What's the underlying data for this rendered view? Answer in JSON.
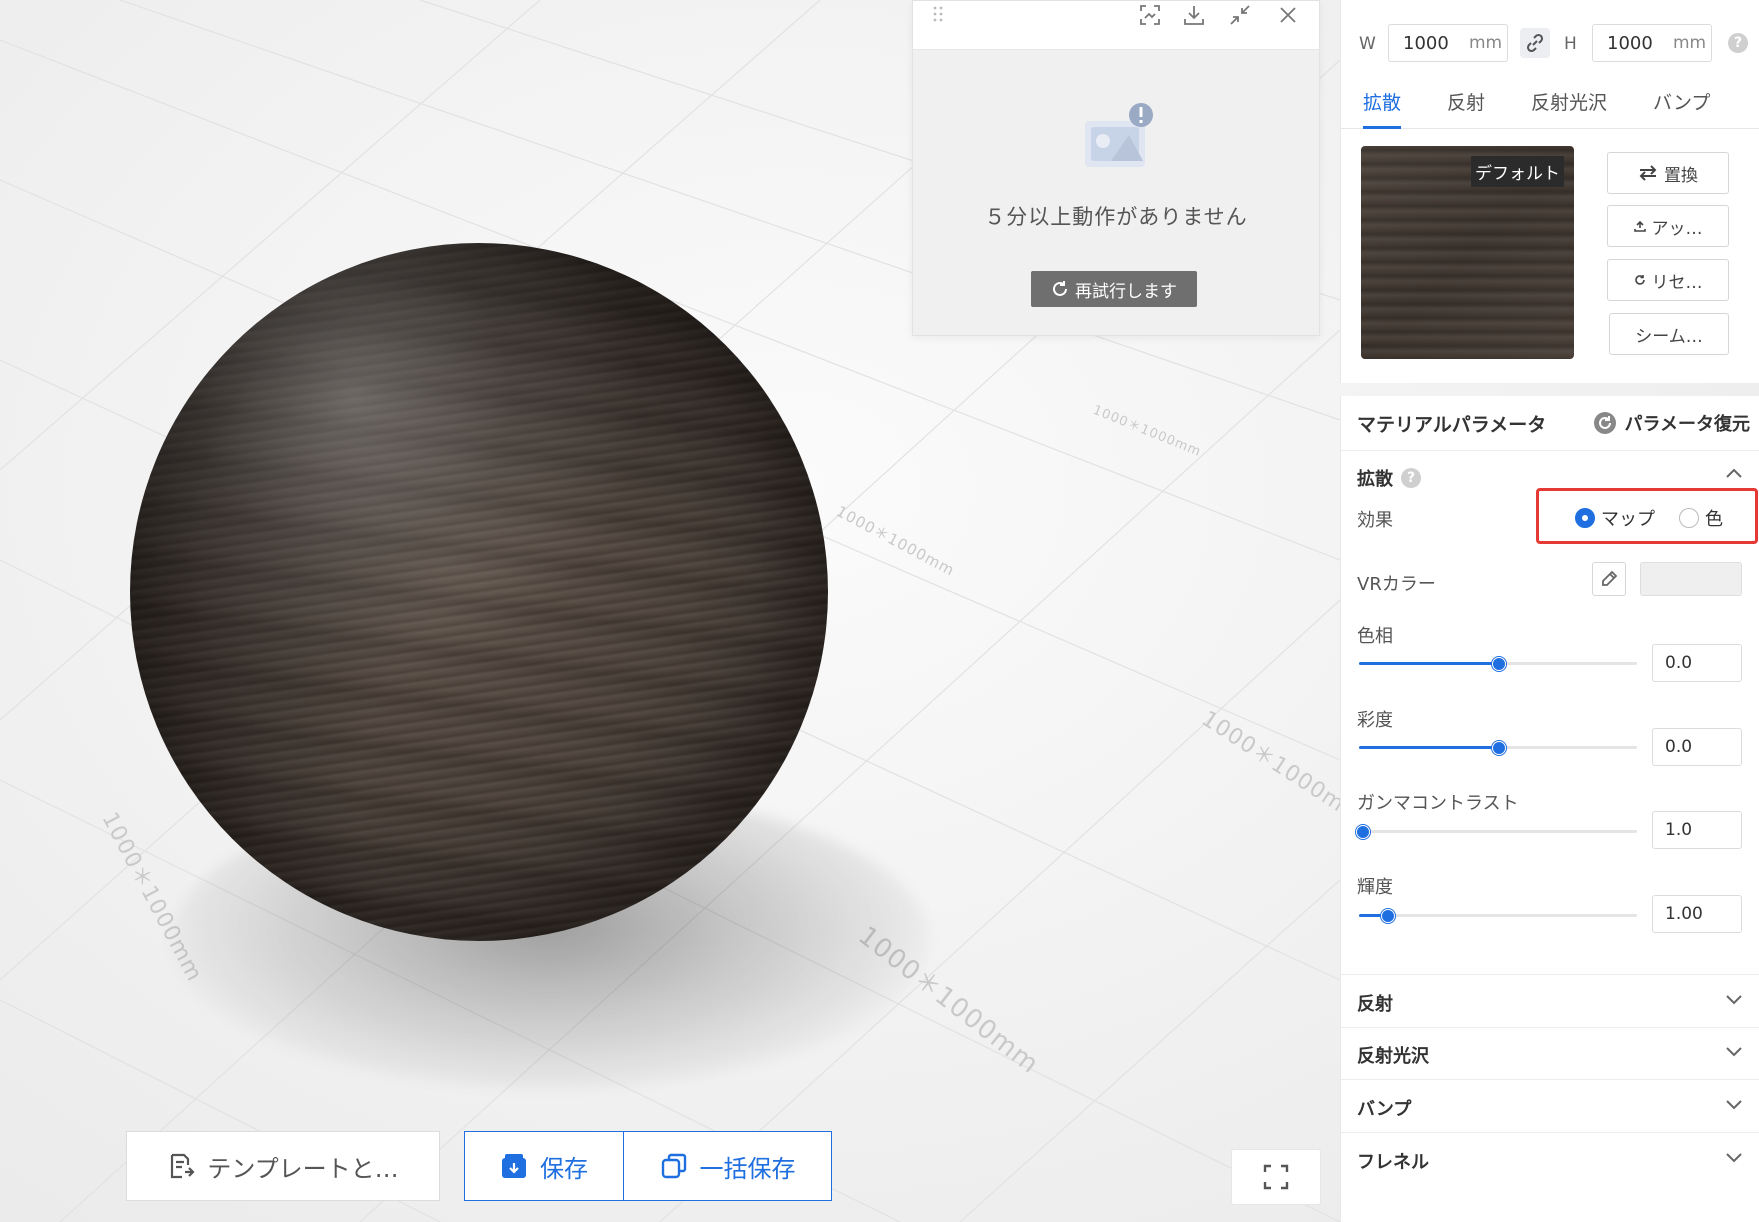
{
  "viewport": {
    "grid_labels": [
      "1000＊1000mm",
      "1000＊1000mm",
      "1000＊1000mm",
      "1000＊1000mm",
      "1000＊1000mm"
    ]
  },
  "status_card": {
    "message": "５分以上動作がありません",
    "retry_label": "再試行します"
  },
  "bottom_toolbar": {
    "template_label": "テンプレートと…",
    "save_label": "保存",
    "batch_save_label": "一括保存"
  },
  "dimensions": {
    "w_label": "W",
    "w_value": "1000",
    "w_unit": "mm",
    "h_label": "H",
    "h_value": "1000",
    "h_unit": "mm",
    "help": "?"
  },
  "tabs": [
    {
      "label": "拡散",
      "active": true
    },
    {
      "label": "反射",
      "active": false
    },
    {
      "label": "反射光沢",
      "active": false
    },
    {
      "label": "バンプ",
      "active": false
    }
  ],
  "texture": {
    "tag": "デフォルト",
    "replace_label": "置換",
    "upload_label": "アッ…",
    "reset_label": "リセ…",
    "seamless_label": "シーム…"
  },
  "params": {
    "title": "マテリアルパラメータ",
    "restore_label": "パラメータ復元",
    "diffuse": {
      "title": "拡散",
      "effect_label": "効果",
      "options": [
        {
          "label": "マップ",
          "selected": true
        },
        {
          "label": "色",
          "selected": false
        }
      ],
      "vr_color_label": "VRカラー",
      "vr_color_value": "#efefef",
      "sliders": [
        {
          "label": "色相",
          "value": "0.0",
          "fraction": 0.5
        },
        {
          "label": "彩度",
          "value": "0.0",
          "fraction": 0.5
        },
        {
          "label": "ガンマコントラスト",
          "value": "1.0",
          "fraction": 0.01
        },
        {
          "label": "輝度",
          "value": "1.00",
          "fraction": 0.1
        }
      ]
    },
    "sections": [
      {
        "label": "反射"
      },
      {
        "label": "反射光沢"
      },
      {
        "label": "バンプ"
      },
      {
        "label": "フレネル"
      }
    ]
  },
  "colors": {
    "accent": "#1f6fe0",
    "highlight_border": "#e53935"
  }
}
